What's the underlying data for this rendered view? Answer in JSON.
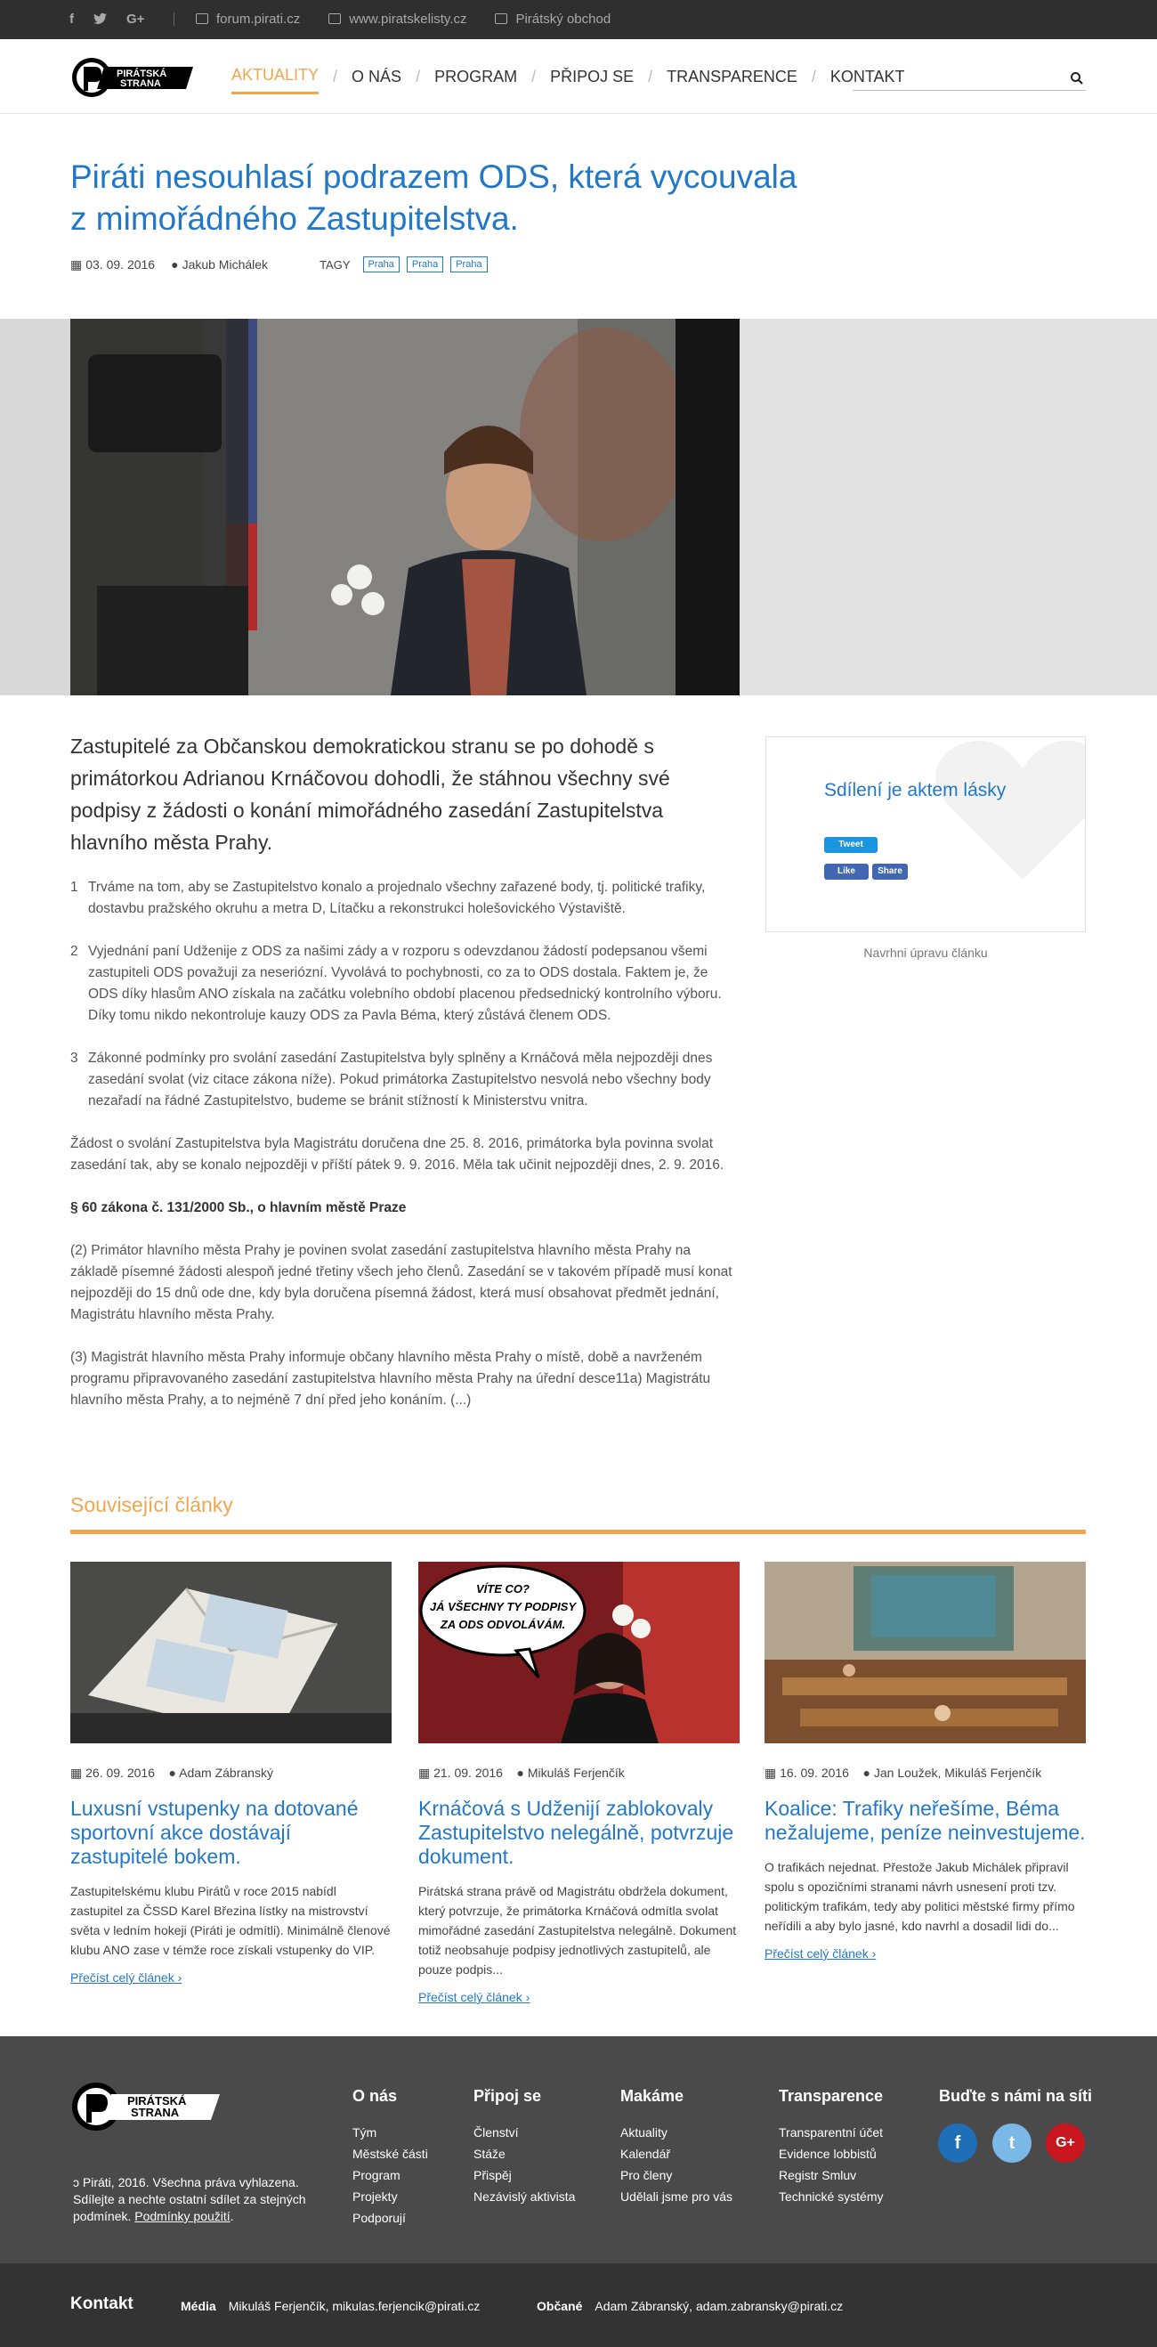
{
  "topbar": {
    "links": [
      {
        "label": "forum.pirati.cz",
        "icon": "comments-icon"
      },
      {
        "label": "www.piratskelisty.cz",
        "icon": "newspaper-icon"
      },
      {
        "label": "Pirátský obchod",
        "icon": "shop-icon"
      }
    ]
  },
  "logo": {
    "line1": "PIRÁTSKÁ",
    "line2": "STRANA"
  },
  "nav": [
    "AKTUALITY",
    "O NÁS",
    "PROGRAM",
    "PŘIPOJ SE",
    "TRANSPARENCE",
    "KONTAKT"
  ],
  "article": {
    "title": "Piráti nesouhlasí podrazem ODS, která vycouvala z mimořádného Zastupitelstva.",
    "date": "03. 09. 2016",
    "author": "Jakub Michálek",
    "tags_label": "TAGY",
    "tags": [
      "Praha",
      "Praha",
      "Praha"
    ],
    "lead": "Zastupitelé za Občanskou demokratickou stranu se po dohodě s primátorkou Adrianou Krnáčovou dohodli, že stáhnou všechny své podpisy z žádosti o konání mimořádného zasedání Zastupitelstva hlavního města Prahy.",
    "points": [
      {
        "n": "1",
        "text": "Trváme na tom, aby se Zastupitelstvo konalo a projednalo všechny zařazené body, tj. politické trafiky, dostavbu pražského okruhu a metra D, Lítačku a rekonstrukci holešovického Výstaviště."
      },
      {
        "n": "2",
        "text": "Vyjednání paní Udženije z ODS za našimi zády a v rozporu s odevzdanou žádostí podepsanou všemi zastupiteli ODS považuji za neseriózní. Vyvolává to pochybnosti, co za to ODS dostala. Faktem je, že ODS díky hlasům ANO získala na začátku volebního období placenou předsednický kontrolního výboru. Díky tomu nikdo nekontroluje kauzy ODS za Pavla Béma, který zůstává členem ODS."
      },
      {
        "n": "3",
        "text": " Zákonné podmínky pro svolání zasedání Zastupitelstva byly splněny a Krnáčová měla nejpozději dnes zasedání svolat (viz citace zákona níže). Pokud primátorka Zastupitelstvo nesvolá nebo všechny body nezařadí na řádné Zastupitelstvo, budeme se bránit stížností k Ministerstvu vnitra."
      }
    ],
    "para1": "Žádost o svolání Zastupitelstva byla Magistrátu doručena dne 25. 8. 2016, primátorka byla povinna svolat zasedání tak, aby se konalo nejpozději v příští pátek 9. 9. 2016. Měla tak učinit nejpozději dnes, 2. 9. 2016.",
    "law": "§ 60 zákona č. 131/2000 Sb., o hlavním městě Praze",
    "para2": "(2) Primátor hlavního města Prahy je povinen svolat zasedání zastupitelstva hlavního města Prahy na základě písemné žádosti alespoň jedné třetiny všech jeho členů. Zasedání se v takovém případě musí konat nejpozději do 15 dnů ode dne, kdy byla doručena písemná žádost, která musí obsahovat předmět jednání, Magistrátu hlavního města Prahy.",
    "para3": "(3) Magistrát hlavního města Prahy informuje občany hlavního města Prahy o místě, době a navrženém programu připravovaného zasedání zastupitelstva hlavního města Prahy na úřední desce11a) Magistrátu hlavního města Prahy, a to nejméně 7 dní před jeho konáním. (...)"
  },
  "share": {
    "heading": "Sdílení je aktem lásky",
    "tweet": "Tweet",
    "like": "Like",
    "share": "Share",
    "suggest": "Navrhni úpravu článku"
  },
  "related": {
    "heading": "Související články",
    "read_more": "Přečíst celý článek ›",
    "cards": [
      {
        "date": "26. 09. 2016",
        "author": "Adam Zábranský",
        "title": "Luxusní vstupenky na dotované sportovní akce dostávají zastupitelé bokem.",
        "text": "Zastupitelskému klubu Pirátů v roce 2015 nabídl zastupitel za ČSSD Karel Březina lístky na mistrovství světa v ledním hokeji (Piráti je odmítli). Minimálně členové klubu ANO zase v témže roce získali vstupenky do VIP."
      },
      {
        "date": "21. 09. 2016",
        "author": "Mikuláš Ferjenčík",
        "title": "Krnáčová s Udženijí zablokovaly Zastupitelstvo nelegálně, potvrzuje dokument.",
        "text": "Pirátská strana právě od Magistrátu obdržela dokument, který potvrzuje, že primátorka Krnáčová odmítla svolat mimořádné zasedání Zastupitelstva nelegálně. Dokument totiž neobsahuje podpisy jednotlivých zastupitelů, ale pouze podpis...",
        "bubble": "VÍTE CO? JÁ VŠECHNY TY PODPISY ZA ODS ODVOLÁVÁM."
      },
      {
        "date": "16. 09. 2016",
        "author": "Jan Loužek, Mikuláš Ferjenčík",
        "title": "Koalice: Trafiky neřešíme, Béma nežalujeme, peníze neinvestujeme.",
        "text": "O trafikách nejednat. Přestože Jakub Michálek připravil spolu s opozičními stranami návrh usnesení proti tzv. politickým trafikám, tedy aby politici městské firmy přímo neřídili a aby bylo jasné, kdo navrhl a dosadil lidi do..."
      }
    ]
  },
  "footer": {
    "copyright": "Piráti, 2016. Všechna práva vyhlazena. Sdílejte a nechte ostatní sdílet za stejných podmínek.",
    "terms": "Podmínky použití",
    "columns": [
      {
        "title": "O nás",
        "items": [
          "Tým",
          "Městské části",
          "Program",
          "Projekty",
          "Podporují"
        ]
      },
      {
        "title": "Připoj se",
        "items": [
          "Členství",
          "Stáže",
          "Přispěj",
          "Nezávislý aktivista"
        ]
      },
      {
        "title": "Makáme",
        "items": [
          "Aktuality",
          "Kalendář",
          "Pro členy",
          "Udělali jsme pro vás"
        ]
      },
      {
        "title": "Transparence",
        "items": [
          "Transparentní účet",
          "Evidence lobbistů",
          "Registr Smluv",
          "Technické systémy"
        ]
      }
    ],
    "social_title": "Buďte s námi na síti",
    "social": [
      {
        "icon": "facebook-icon",
        "glyph": "f",
        "color": "#1e6fb8"
      },
      {
        "icon": "twitter-icon",
        "glyph": "t",
        "color": "#7ab8e8"
      },
      {
        "icon": "google-plus-icon",
        "glyph": "G+",
        "color": "#c8171f"
      }
    ]
  },
  "contact": {
    "heading": "Kontakt",
    "media_label": "Média",
    "media_value": "Mikuláš Ferjenčík, mikulas.ferjencik@pirati.cz",
    "citizens_label": "Občané",
    "citizens_value": "Adam Zábranský, adam.zabransky@pirati.cz"
  },
  "colors": {
    "accent": "#f0a64f",
    "link": "#2278c6",
    "footer": "#4a4a4a"
  }
}
